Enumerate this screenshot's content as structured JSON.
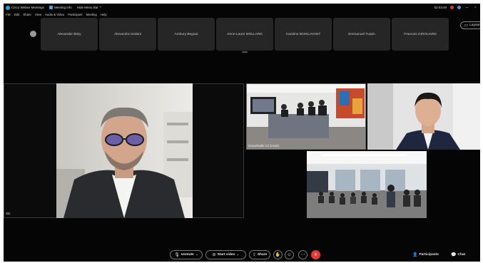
{
  "window": {
    "app_title": "Cisco Webex Meetings",
    "meeting_info": "Meeting Info",
    "hide_menu_bar": "Hide Menu Bar",
    "timer": "02:03:49"
  },
  "menu": [
    "File",
    "Edit",
    "Share",
    "View",
    "Audio & Video",
    "Participant",
    "Meeting",
    "Help"
  ],
  "participants_strip": [
    "Alexander Bitzy",
    "Alexandra Sedani",
    "Ambury Begout",
    "Anne-Laure MOLLARD",
    "Caroline BOIXLAVANT",
    "Emmanuel Turpin",
    "Francois GIROUARD"
  ],
  "layout_button": {
    "label": "Layout"
  },
  "main_video": {
    "label": "Xtx"
  },
  "gallery": [
    {
      "label": "GrandSalle C2 (Host)"
    },
    {
      "label": ""
    },
    {
      "label": ""
    }
  ],
  "toolbar": {
    "unmute": "Unmute",
    "start_video": "Start video",
    "share": "Share",
    "participants": "Participants",
    "chat": "Chat"
  },
  "icons": {
    "mic": "mic-muted-icon",
    "video": "video-off-icon",
    "share": "share-icon",
    "hand": "raise-hand-icon",
    "emoji": "reactions-icon",
    "more": "more-icon",
    "leave": "leave-icon",
    "participants": "participants-icon",
    "chat": "chat-icon",
    "layout": "layout-icon"
  },
  "colors": {
    "background": "#050505",
    "tile": "#262626",
    "leave": "#e53935",
    "host_border": "#6a6a6a",
    "app_logo": "#2b9fd8"
  }
}
